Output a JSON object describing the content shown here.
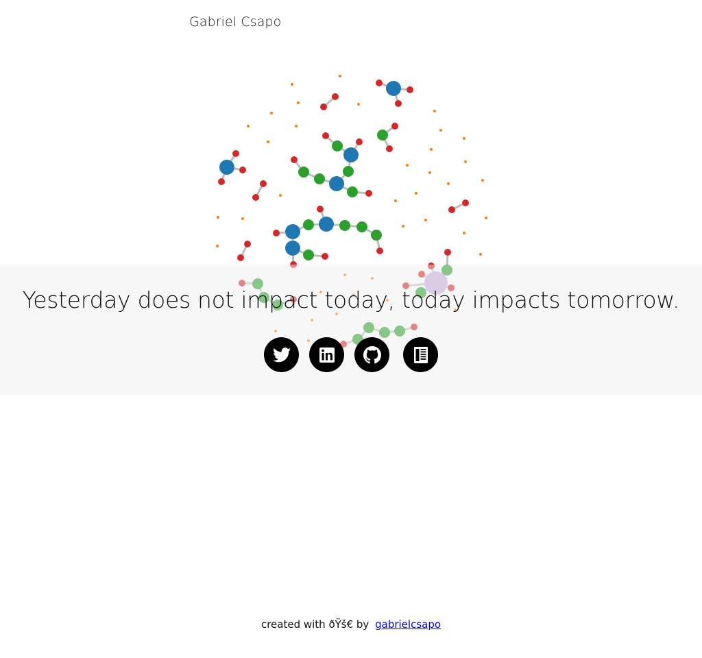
{
  "header": {
    "site_name": "Gabriel Csapo"
  },
  "hero": {
    "quote": "Yesterday does not impact today, today impacts tomorrow."
  },
  "socials": [
    {
      "name": "twitter",
      "icon": "twitter-icon"
    },
    {
      "name": "linkedin",
      "icon": "linkedin-icon"
    },
    {
      "name": "github",
      "icon": "github-icon"
    },
    {
      "name": "blog",
      "icon": "newspaper-icon"
    }
  ],
  "footer": {
    "text": "created with ðŸš€ by",
    "link_text": "gabrielcsapo"
  },
  "colors": {
    "blue": "#1f77b4",
    "green": "#2ca02c",
    "red": "#d62728",
    "orange": "#ff7f0e",
    "purple": "#c5a9d6",
    "link": "#0000ee",
    "band": "#f7f7f7"
  }
}
